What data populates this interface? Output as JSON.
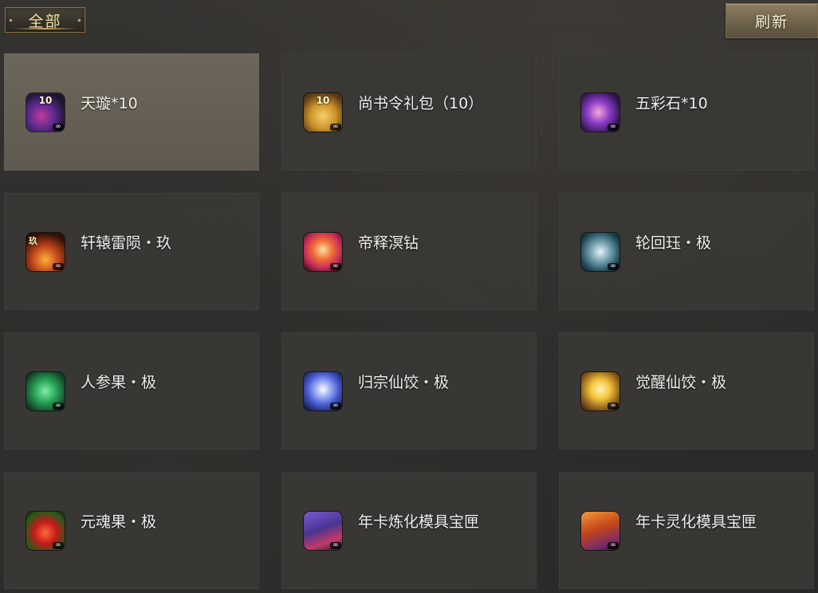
{
  "header": {
    "filter_tab_label": "全部",
    "refresh_label": "刷新"
  },
  "items": [
    {
      "name": "天璇*10",
      "icon": "tianxuan-gem-icon",
      "badge": "10",
      "selected": true
    },
    {
      "name": "尚书令礼包（10）",
      "icon": "gift-bag-icon",
      "badge": "10",
      "selected": false
    },
    {
      "name": "五彩石*10",
      "icon": "colorful-stone-icon",
      "badge": "",
      "selected": false
    },
    {
      "name": "轩辕雷陨・玖",
      "icon": "xuanyuan-thunder-icon",
      "badge": "玖",
      "selected": false
    },
    {
      "name": "帝释溟钻",
      "icon": "diamond-icon",
      "badge": "",
      "selected": false
    },
    {
      "name": "轮回珏・极",
      "icon": "jade-ring-icon",
      "badge": "",
      "selected": false
    },
    {
      "name": "人参果・极",
      "icon": "ginseng-fruit-icon",
      "badge": "",
      "selected": false
    },
    {
      "name": "归宗仙饺・极",
      "icon": "blue-dumpling-icon",
      "badge": "",
      "selected": false
    },
    {
      "name": "觉醒仙饺・极",
      "icon": "gold-dumpling-icon",
      "badge": "",
      "selected": false
    },
    {
      "name": "元魂果・极",
      "icon": "soul-fruit-icon",
      "badge": "",
      "selected": false
    },
    {
      "name": "年卡炼化模具宝匣",
      "icon": "purple-chest-icon",
      "badge": "",
      "selected": false
    },
    {
      "name": "年卡灵化模具宝匣",
      "icon": "orange-chest-icon",
      "badge": "",
      "selected": false
    }
  ],
  "infinity_mark": "∞",
  "colors": {
    "accent_gold": "#c9a968",
    "card_bg": "#3a3835",
    "card_selected_bg": "#6d665b",
    "text": "#f2f0ec"
  }
}
